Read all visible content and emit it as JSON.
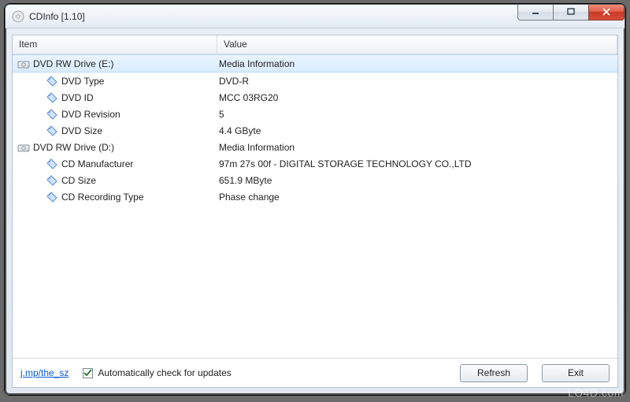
{
  "window": {
    "title": "CDInfo [1.10]"
  },
  "columns": {
    "item": "Item",
    "value": "Value"
  },
  "rows": [
    {
      "icon": "drive",
      "indent": 0,
      "selected": true,
      "item": "DVD RW Drive (E:)",
      "value": "Media Information"
    },
    {
      "icon": "tag",
      "indent": 1,
      "selected": false,
      "item": "DVD Type",
      "value": "DVD-R"
    },
    {
      "icon": "tag",
      "indent": 1,
      "selected": false,
      "item": "DVD ID",
      "value": "MCC 03RG20"
    },
    {
      "icon": "tag",
      "indent": 1,
      "selected": false,
      "item": "DVD Revision",
      "value": "5"
    },
    {
      "icon": "tag",
      "indent": 1,
      "selected": false,
      "item": "DVD Size",
      "value": "4.4 GByte"
    },
    {
      "icon": "drive",
      "indent": 0,
      "selected": false,
      "item": "DVD RW Drive (D:)",
      "value": "Media Information"
    },
    {
      "icon": "tag",
      "indent": 1,
      "selected": false,
      "item": "CD Manufacturer",
      "value": "97m 27s 00f - DIGITAL STORAGE TECHNOLOGY CO.,LTD"
    },
    {
      "icon": "tag",
      "indent": 1,
      "selected": false,
      "item": "CD Size",
      "value": "651.9 MByte"
    },
    {
      "icon": "tag",
      "indent": 1,
      "selected": false,
      "item": "CD Recording Type",
      "value": "Phase change"
    }
  ],
  "footer": {
    "link": "j.mp/the_sz",
    "checkbox_label": "Automatically check for updates",
    "checkbox_checked": true,
    "refresh": "Refresh",
    "exit": "Exit"
  },
  "watermark": "LO4D.com"
}
